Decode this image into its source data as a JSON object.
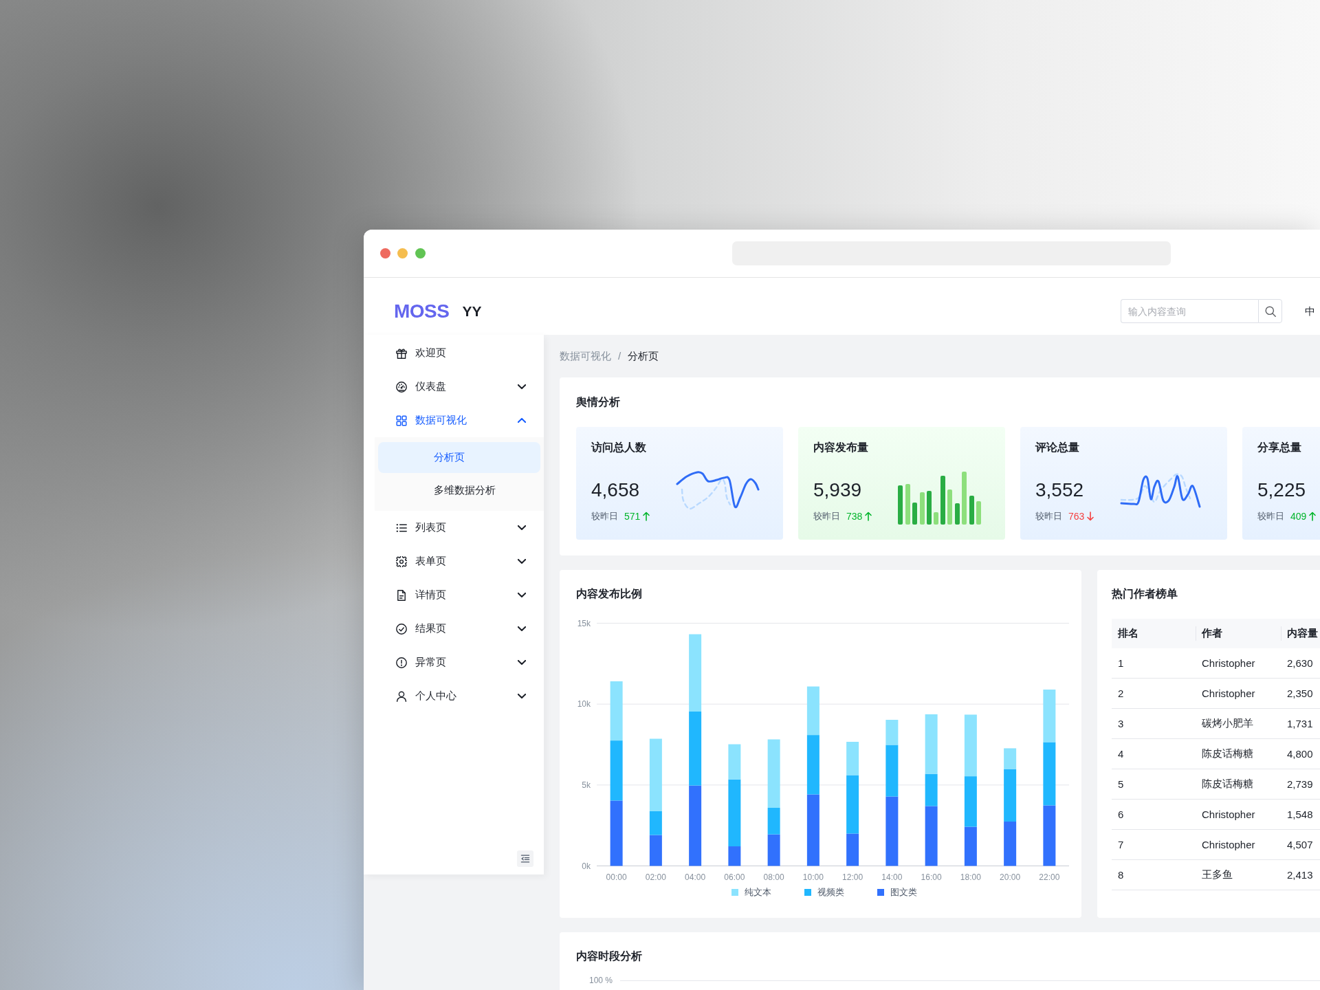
{
  "header": {
    "logo": "MOSS",
    "app_name": "YY",
    "search": {
      "placeholder": "输入内容查询"
    },
    "language": "中"
  },
  "sidebar": {
    "items": [
      {
        "label": "欢迎页",
        "selected": false
      },
      {
        "label": "仪表盘",
        "selected": false,
        "expanded": false
      },
      {
        "label": "数据可视化",
        "selected": true,
        "expanded": true,
        "children": [
          {
            "label": "分析页",
            "selected": true
          },
          {
            "label": "多维数据分析",
            "selected": false
          }
        ]
      },
      {
        "label": "列表页",
        "selected": false,
        "expanded": false
      },
      {
        "label": "表单页",
        "selected": false,
        "expanded": false
      },
      {
        "label": "详情页",
        "selected": false,
        "expanded": false
      },
      {
        "label": "结果页",
        "selected": false,
        "expanded": false
      },
      {
        "label": "异常页",
        "selected": false,
        "expanded": false
      },
      {
        "label": "个人中心",
        "selected": false,
        "expanded": false
      }
    ]
  },
  "breadcrumb": {
    "items": [
      "数据可视化",
      "分析页"
    ],
    "separator": "/"
  },
  "sentiment": {
    "title": "舆情分析",
    "cards": [
      {
        "title": "访问总人数",
        "value": "4,658",
        "compare_label": "较昨日",
        "change": "571",
        "increase": true,
        "kind": "line"
      },
      {
        "title": "内容发布量",
        "value": "5,939",
        "compare_label": "较昨日",
        "change": "738",
        "increase": true,
        "kind": "bar"
      },
      {
        "title": "评论总量",
        "value": "3,552",
        "compare_label": "较昨日",
        "change": "763",
        "increase": false,
        "kind": "line"
      },
      {
        "title": "分享总量",
        "value": "5,225",
        "compare_label": "较昨日",
        "change": "409",
        "increase": true,
        "kind": "plain"
      }
    ]
  },
  "content_ratio": {
    "chart_data": {
      "type": "bar",
      "title": "内容发布比例",
      "stacked": true,
      "legend": "bottom",
      "categories": [
        "00:00",
        "02:00",
        "04:00",
        "06:00",
        "08:00",
        "10:00",
        "12:00",
        "14:00",
        "16:00",
        "18:00",
        "20:00",
        "22:00"
      ],
      "series": [
        {
          "name": "纯文本",
          "color": "#8be3fe",
          "values": [
            3660,
            4480,
            4780,
            2170,
            4230,
            3000,
            2060,
            1550,
            3680,
            3810,
            1280,
            3250
          ]
        },
        {
          "name": "视频类",
          "color": "#20b7fe",
          "values": [
            3710,
            1470,
            4570,
            4140,
            1640,
            3670,
            3610,
            3190,
            1990,
            3120,
            3250,
            3910
          ]
        },
        {
          "name": "图文类",
          "color": "#3171fd",
          "values": [
            4040,
            1910,
            4970,
            1210,
            1950,
            4420,
            2000,
            4290,
            3700,
            2420,
            2740,
            3740
          ]
        }
      ],
      "ylim": [
        0,
        15000
      ],
      "yticks": [
        {
          "value": 0,
          "label": "0k"
        },
        {
          "value": 5000,
          "label": "5k"
        },
        {
          "value": 10000,
          "label": "10k"
        },
        {
          "value": 15000,
          "label": "15k"
        }
      ]
    }
  },
  "top_authors": {
    "title": "热门作者榜单",
    "columns": [
      "排名",
      "作者",
      "内容量"
    ],
    "rows": [
      [
        "1",
        "Christopher",
        "2,630"
      ],
      [
        "2",
        "Christopher",
        "2,350"
      ],
      [
        "3",
        "碳烤小肥羊",
        "1,731"
      ],
      [
        "4",
        "陈皮话梅糖",
        "4,800"
      ],
      [
        "5",
        "陈皮话梅糖",
        "2,739"
      ],
      [
        "6",
        "Christopher",
        "1,548"
      ],
      [
        "7",
        "Christopher",
        "4,507"
      ],
      [
        "8",
        "王多鱼",
        "2,413"
      ]
    ]
  },
  "time_analysis": {
    "title": "内容时段分析",
    "y_tick": "100 %"
  }
}
